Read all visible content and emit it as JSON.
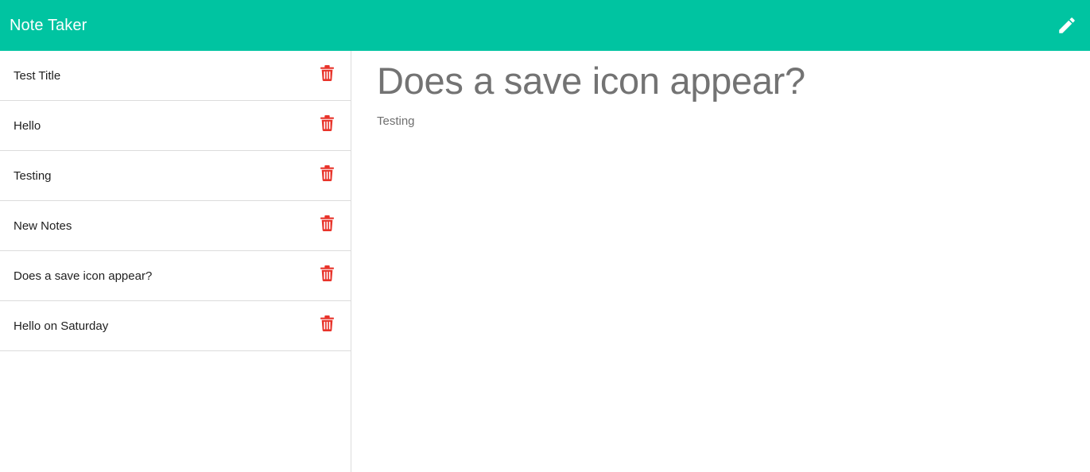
{
  "header": {
    "title": "Note Taker",
    "new_note_icon": "pencil-icon"
  },
  "colors": {
    "navbar": "#00c4a1",
    "delete_icon": "#e8332a",
    "border": "#dcdcdc"
  },
  "sidebar": {
    "notes": [
      {
        "title": "Test Title",
        "delete_icon": "trash-icon"
      },
      {
        "title": "Hello",
        "delete_icon": "trash-icon"
      },
      {
        "title": "Testing",
        "delete_icon": "trash-icon"
      },
      {
        "title": "New Notes",
        "delete_icon": "trash-icon"
      },
      {
        "title": "Does a save icon appear?",
        "delete_icon": "trash-icon"
      },
      {
        "title": "Hello on Saturday",
        "delete_icon": "trash-icon"
      }
    ]
  },
  "editor": {
    "title": "Does a save icon appear?",
    "body": "Testing"
  }
}
